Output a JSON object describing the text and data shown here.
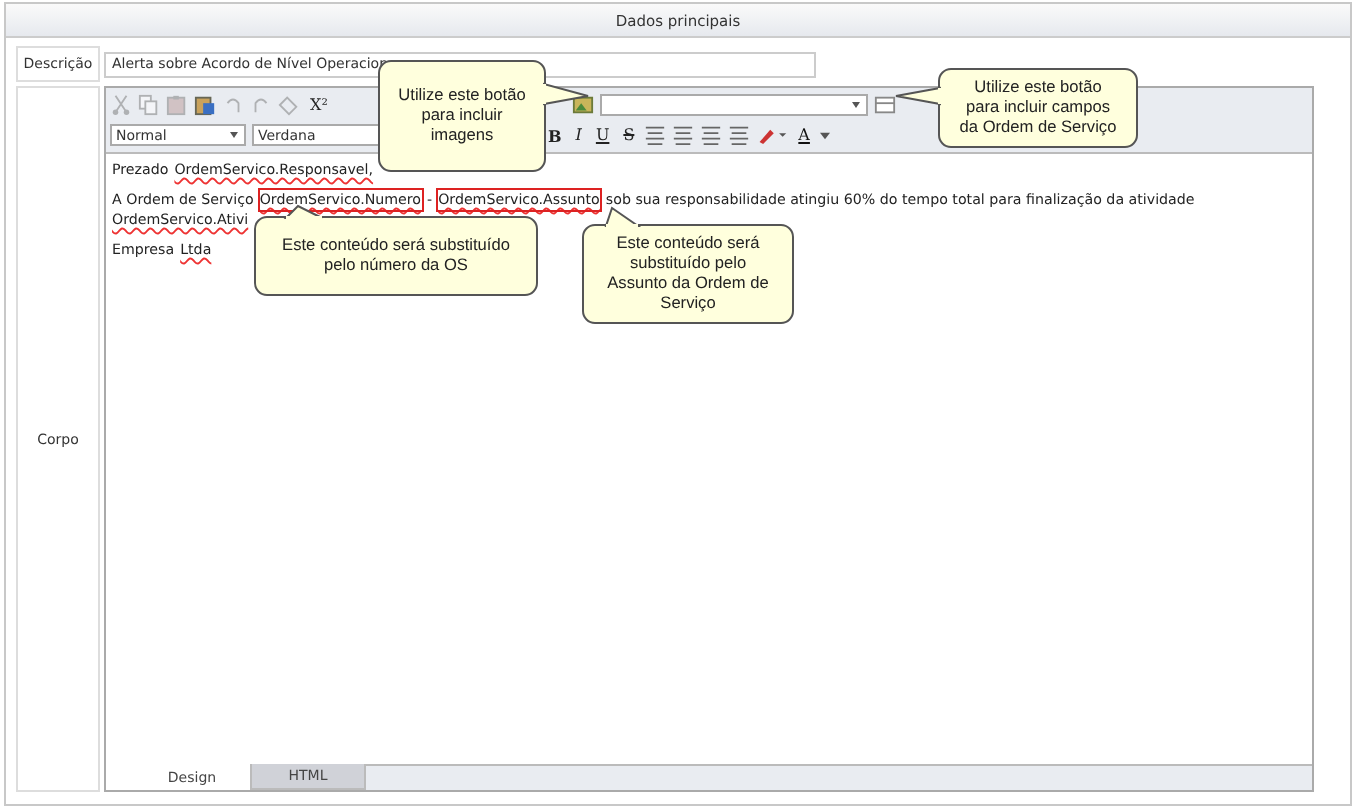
{
  "panel": {
    "title": "Dados principais"
  },
  "fields": [
    {
      "label": "Descrição",
      "value": "Alerta sobre Acordo de Nível Operacion"
    }
  ],
  "body": {
    "label": "Corpo",
    "toolbar_1": [
      {
        "kind": "cut",
        "disabled": true
      },
      {
        "kind": "copy",
        "disabled": true
      },
      {
        "kind": "paste",
        "disabled": true
      },
      {
        "kind": "paste-word",
        "disabled": false
      },
      {
        "kind": "undo",
        "disabled": true
      },
      {
        "kind": "redo",
        "disabled": true
      },
      {
        "kind": "spell",
        "disabled": true
      },
      {
        "kind": "text",
        "text": "X²",
        "disabled": false
      }
    ],
    "toolbar_1_end": [
      {
        "kind": "image"
      },
      {
        "kind": "dropdown"
      },
      {
        "kind": "field"
      }
    ],
    "format_select": "Normal",
    "font_select": "Verdana",
    "toolbar_2": [
      {
        "kind": "bold",
        "text": "B"
      },
      {
        "kind": "italic",
        "text": "I"
      },
      {
        "kind": "underline",
        "text": "U"
      },
      {
        "kind": "strike",
        "text": "S"
      },
      {
        "kind": "align"
      },
      {
        "kind": "align"
      },
      {
        "kind": "align"
      },
      {
        "kind": "align"
      },
      {
        "kind": "highlight"
      },
      {
        "kind": "color",
        "text": "A"
      }
    ],
    "content": [
      {
        "parts": [
          {
            "text": "Prezado",
            "spell": false
          },
          {
            "text": "OrdemServico.Responsavel,",
            "spell": true
          }
        ]
      },
      {
        "parts": [
          {
            "text": "A Ordem de Serviço",
            "spell": false
          },
          {
            "text": "OrdemServico.Numero",
            "marked": true,
            "spell": true
          },
          {
            "text": "-"
          },
          {
            "text": "OrdemServico.Assunto",
            "marked": true,
            "spell": true
          },
          {
            "text": "sob sua responsabilidade atingiu 60% do tempo total para finalização da atividade",
            "spell": false
          },
          {
            "text": "OrdemServico.Ativi",
            "spell": true
          }
        ]
      },
      {
        "parts": [
          {
            "text": "Empresa",
            "spell": false
          },
          {
            "text": "Ltda",
            "spell": true
          }
        ]
      }
    ],
    "tabs": [
      {
        "label": "Design",
        "selected": true
      },
      {
        "label": "HTML",
        "selected": false
      }
    ]
  },
  "callouts": [
    {
      "text": "Utilize este botão para incluir imagens"
    },
    {
      "text": "Utilize este botão para incluir campos da Ordem de Serviço"
    },
    {
      "text": "Este conteúdo será substituído pelo número da OS"
    },
    {
      "text": "Este conteúdo será substituído pelo Assunto da Ordem de Serviço"
    }
  ]
}
